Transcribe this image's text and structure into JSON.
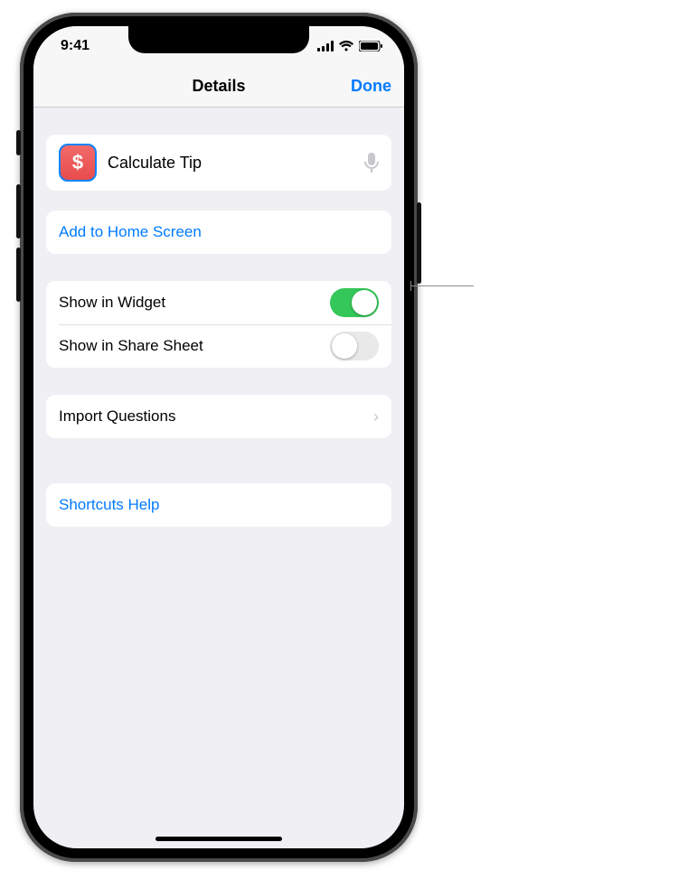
{
  "status": {
    "time": "9:41"
  },
  "nav": {
    "title": "Details",
    "done": "Done"
  },
  "shortcut": {
    "glyph": "$",
    "name": "Calculate Tip"
  },
  "actions": {
    "addHome": "Add to Home Screen"
  },
  "toggles": {
    "widget": {
      "label": "Show in Widget",
      "on": true
    },
    "share": {
      "label": "Show in Share Sheet",
      "on": false
    }
  },
  "import": {
    "label": "Import Questions"
  },
  "help": {
    "label": "Shortcuts Help"
  }
}
